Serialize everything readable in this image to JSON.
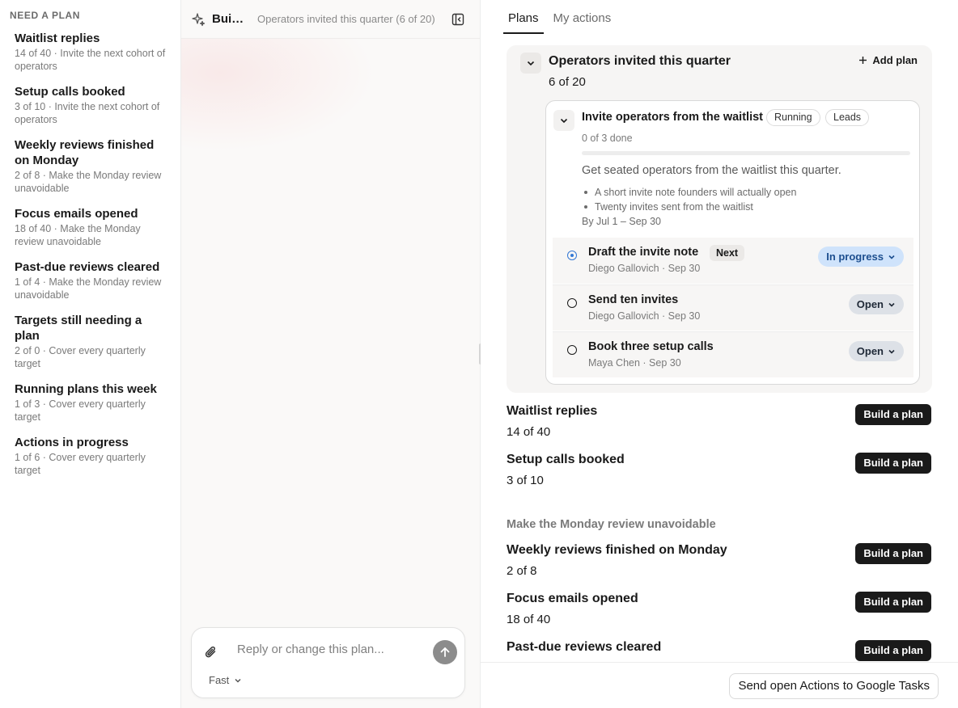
{
  "sidebar": {
    "heading": "NEED A PLAN",
    "items": [
      {
        "title": "Waitlist replies",
        "sub": "14 of 40 · Invite the next cohort of operators"
      },
      {
        "title": "Setup calls booked",
        "sub": "3 of 10 · Invite the next cohort of operators"
      },
      {
        "title": "Weekly reviews finished on Monday",
        "sub": "2 of 8 · Make the Monday review unavoidable"
      },
      {
        "title": "Focus emails opened",
        "sub": "18 of 40 · Make the Monday review unavoidable"
      },
      {
        "title": "Past-due reviews cleared",
        "sub": "1 of 4 · Make the Monday review unavoidable"
      },
      {
        "title": "Targets still needing a plan",
        "sub": "2 of 0 · Cover every quarterly target"
      },
      {
        "title": "Running plans this week",
        "sub": "1 of 3 · Cover every quarterly target"
      },
      {
        "title": "Actions in progress",
        "sub": "1 of 6 · Cover every quarterly target"
      }
    ]
  },
  "chat": {
    "title": "Building a plan",
    "subtitle": "Operators invited this quarter (6 of 20)",
    "composer": {
      "placeholder": "Reply or change this plan...",
      "model": "Fast"
    }
  },
  "plans": {
    "tabs": [
      {
        "label": "Plans",
        "active": true
      },
      {
        "label": "My actions",
        "active": false
      }
    ],
    "group": {
      "title": "Operators invited this quarter",
      "progress": "6 of 20",
      "add_plan": "Add plan",
      "plan": {
        "title": "Invite operators from the waitlist",
        "badges": [
          "Running",
          "Leads"
        ],
        "done": "0 of 3 done",
        "progress_fraction": 0,
        "goal": "Get seated operators from the waitlist this quarter.",
        "bullets": [
          "A short invite note founders will actually open",
          "Twenty invites sent from the waitlist"
        ],
        "dates": "By Jul 1 – Sep 30",
        "actions": [
          {
            "title": "Draft the invite note",
            "tag": "Next",
            "meta": "Diego Gallovich · Sep 30",
            "status": "In progress"
          },
          {
            "title": "Send ten invites",
            "meta": "Diego Gallovich · Sep 30",
            "status": "Open"
          },
          {
            "title": "Book three setup calls",
            "meta": "Maya Chen · Sep 30",
            "status": "Open"
          }
        ]
      }
    },
    "goals_a": [
      {
        "title": "Waitlist replies",
        "progress": "14 of 40",
        "button": "Build a plan"
      },
      {
        "title": "Setup calls booked",
        "progress": "3 of 10",
        "button": "Build a plan"
      }
    ],
    "section_label": "Make the Monday review unavoidable",
    "goals_b": [
      {
        "title": "Weekly reviews finished on Monday",
        "progress": "2 of 8",
        "button": "Build a plan"
      },
      {
        "title": "Focus emails opened",
        "progress": "18 of 40",
        "button": "Build a plan"
      },
      {
        "title": "Past-due reviews cleared",
        "progress": "",
        "button": "Build a plan"
      }
    ],
    "footer_button": "Send open Actions to Google Tasks"
  },
  "colors": {
    "accent_blue": "#3478d4",
    "in_progress_bg": "#cfe3fb",
    "open_bg": "#dde1e7",
    "primary_button": "#1a1a1a"
  }
}
